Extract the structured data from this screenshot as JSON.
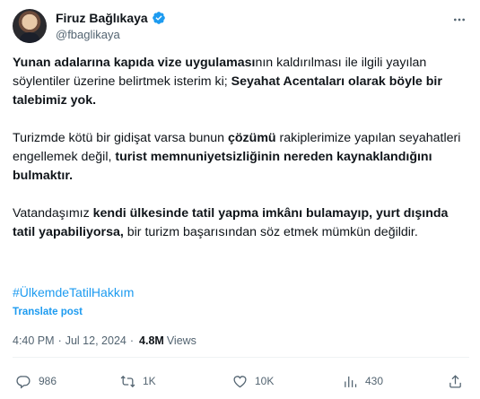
{
  "author": {
    "name": "Firuz Bağlıkaya",
    "handle": "@fbaglikaya"
  },
  "tweet": {
    "p1": {
      "b1": "Yunan adalarına kapıda vize uygulaması",
      "t1": "nın kaldırılması ile ilgili yayılan söylentiler üzerine belirtmek isterim ki; ",
      "b2": "Seyahat Acentaları olarak böyle bir talebimiz yok."
    },
    "p2": {
      "t1": "Turizmde kötü bir gidişat varsa bunun ",
      "b1": "çözümü",
      "t2": " rakiplerimize yapılan seyahatleri engellemek değil, ",
      "b2": "turist memnuniyetsizliğinin nereden kaynaklandığını bulmaktır."
    },
    "p3": {
      "t1": "Vatandaşımız ",
      "b1": "kendi ülkesinde tatil yapma imkânı bulamayıp, yurt dışında tatil yapabiliyorsa,",
      "t2": " bir turizm başarısından söz etmek mümkün değildir."
    },
    "hashtag": "#ÜlkemdeTatilHakkım",
    "translate_label": "Translate post"
  },
  "meta": {
    "time": "4:40 PM",
    "separator": "·",
    "date": "Jul 12, 2024",
    "views_count": "4.8M",
    "views_label": "Views"
  },
  "actions": {
    "replies": "986",
    "reposts": "1K",
    "likes": "10K",
    "bookmarks": "430"
  },
  "colors": {
    "accent": "#1d9bf0",
    "text": "#0f1419",
    "muted": "#536471"
  }
}
